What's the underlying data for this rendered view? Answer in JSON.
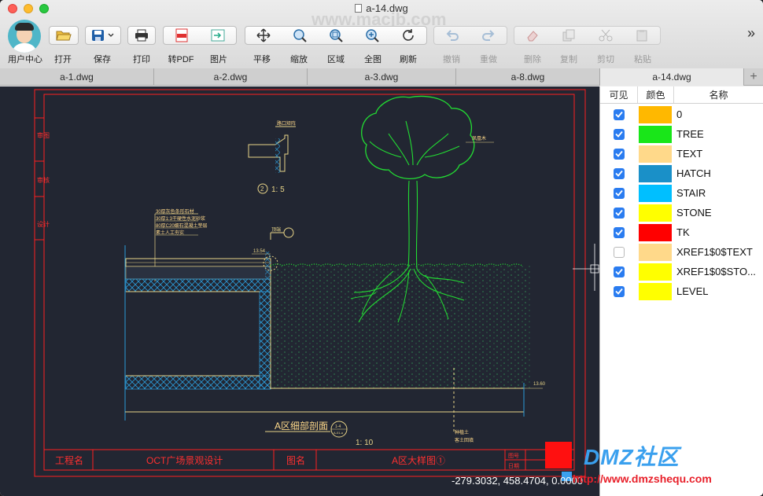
{
  "window": {
    "title": "a-14.dwg",
    "watermark": "www.macjb.com"
  },
  "toolbar": {
    "user": "用户中心",
    "items": [
      {
        "label": "打开",
        "icon": "folder-open-icon",
        "enabled": true
      },
      {
        "label": "保存",
        "icon": "save-icon",
        "enabled": true
      },
      {
        "label": "打印",
        "icon": "printer-icon",
        "enabled": true
      },
      {
        "label": "转PDF",
        "icon": "pdf-icon",
        "enabled": true
      },
      {
        "label": "图片",
        "icon": "image-export-icon",
        "enabled": true
      },
      {
        "label": "平移",
        "icon": "pan-arrows-icon",
        "enabled": true
      },
      {
        "label": "缩放",
        "icon": "zoom-icon",
        "enabled": true
      },
      {
        "label": "区域",
        "icon": "zoom-window-icon",
        "enabled": true
      },
      {
        "label": "全图",
        "icon": "zoom-extents-icon",
        "enabled": true
      },
      {
        "label": "刷新",
        "icon": "refresh-icon",
        "enabled": true
      },
      {
        "label": "撤销",
        "icon": "undo-icon",
        "enabled": false
      },
      {
        "label": "重做",
        "icon": "redo-icon",
        "enabled": false
      },
      {
        "label": "删除",
        "icon": "eraser-icon",
        "enabled": false
      },
      {
        "label": "复制",
        "icon": "copy-icon",
        "enabled": false
      },
      {
        "label": "剪切",
        "icon": "scissors-icon",
        "enabled": false
      },
      {
        "label": "粘贴",
        "icon": "paste-icon",
        "enabled": false
      }
    ],
    "overflow": "»"
  },
  "tabs": [
    "a-1.dwg",
    "a-2.dwg",
    "a-3.dwg",
    "a-8.dwg",
    "a-14.dwg"
  ],
  "active_tab": "a-14.dwg",
  "add_tab": "+",
  "layers_panel": {
    "headers": {
      "visible": "可见",
      "color": "颜色",
      "name": "名称"
    },
    "layers": [
      {
        "name": "0",
        "color": "#FFB800",
        "visible": true
      },
      {
        "name": "TREE",
        "color": "#19E619",
        "visible": true
      },
      {
        "name": "TEXT",
        "color": "#FFD98A",
        "visible": true
      },
      {
        "name": "HATCH",
        "color": "#1A90C8",
        "visible": true
      },
      {
        "name": "STAIR",
        "color": "#00BFFF",
        "visible": true
      },
      {
        "name": "STONE",
        "color": "#FFFF00",
        "visible": true
      },
      {
        "name": "TK",
        "color": "#FF0000",
        "visible": true
      },
      {
        "name": "XREF1$0$TEXT",
        "color": "#FFD98A",
        "visible": false
      },
      {
        "name": "XREF1$0$STO...",
        "color": "#FFFF00",
        "visible": true
      },
      {
        "name": "LEVEL",
        "color": "#FFFF00",
        "visible": true
      }
    ]
  },
  "drawing": {
    "side_labels": [
      "审图",
      "审核",
      "设计"
    ],
    "detail_scale": "1: 5",
    "detail_num": "2",
    "detail_note": "路口矩阵",
    "notes": [
      "30厚灰色条形石材",
      "30厚1:3干硬性水泥砂浆",
      "80厚C20细石混凝土垫层",
      "素土人工夯实"
    ],
    "tree_label": "凤凰木",
    "level_left": "13.54",
    "level_right": "13.60",
    "tag": "顶端",
    "soil_labels": [
      "种植土",
      "客土回填"
    ],
    "section_title": "A区细部剖面",
    "section_scale": "1: 10",
    "bubble_top": "1-4",
    "bubble_bottom": "A-01-a",
    "title_block": {
      "k1": "工程名",
      "v1": "OCT广场景观设计",
      "k2": "图名",
      "v2": "A区大样图①",
      "k3": "图号",
      "k4": "日期"
    }
  },
  "status": {
    "coords": "-279.3032, 458.4704, 0.0000"
  },
  "watermark2": {
    "text": "DMZ社区",
    "url": "http://www.dmzshequ.com"
  },
  "colors": {
    "frame": "#FF2020",
    "linework": "#E8D488",
    "hatch": "#2B9BD8",
    "tree": "#22DD33",
    "active_checkbox": "#2A7CF0"
  }
}
